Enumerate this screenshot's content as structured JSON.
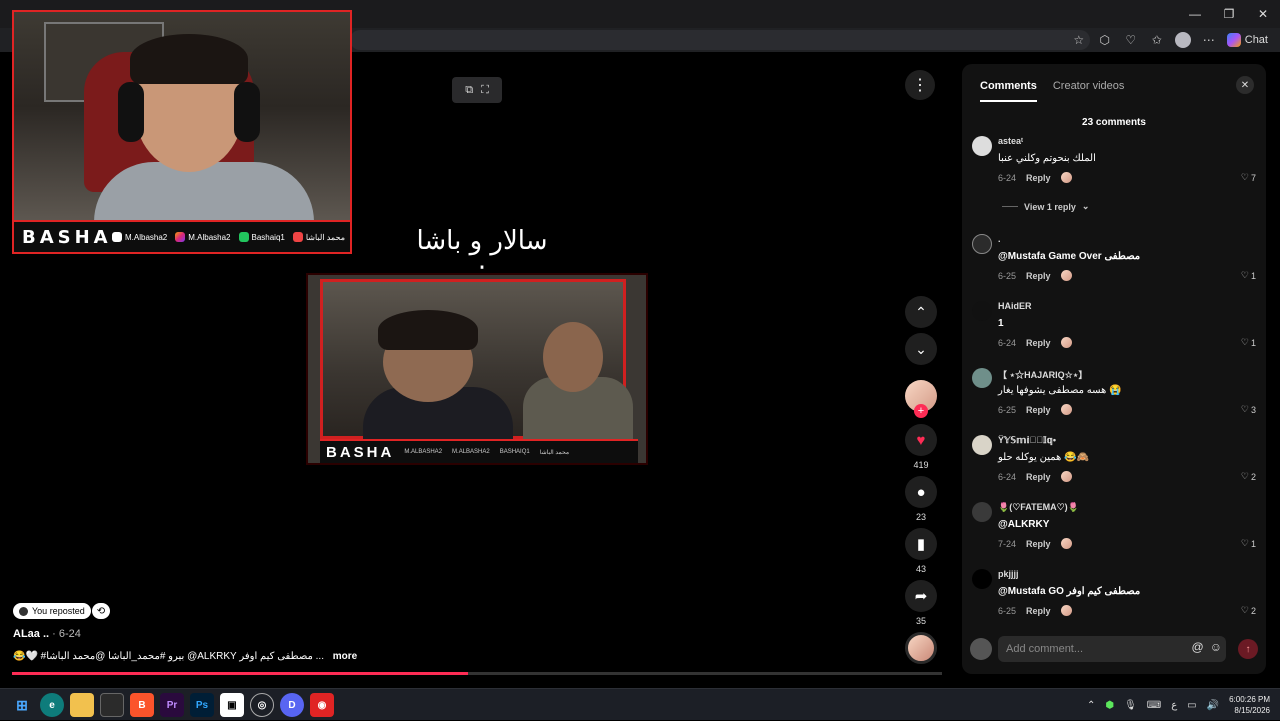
{
  "browser": {
    "chat_label": "Chat"
  },
  "webcam": {
    "brand": "BASHA",
    "socials": [
      "M.Albasha2",
      "M.Albasha2",
      "Bashaiq1",
      "محمد الباشا"
    ]
  },
  "video": {
    "caption": "سالار و باشا :",
    "inner_brand": "BASHA",
    "inner_socials": [
      "M.ALBASHA2",
      "M.ALBASHA2",
      "BASHAIQ1",
      "محمد الباشا"
    ],
    "likes": "419",
    "comments": "23",
    "saves": "43",
    "shares": "35",
    "reposted_label": "You reposted",
    "author": "ALaa ..",
    "date": "· 6-24",
    "description": "😂🤍 #بيرو #محمد_الباشا @محمد الباشا @ALKRKY مصطفى كيم اوفر ...",
    "more_label": "more",
    "progress": 0.49
  },
  "comments_panel": {
    "tabs": [
      "Comments",
      "Creator videos"
    ],
    "total": "23 comments",
    "reply_label": "Reply",
    "view_replies": "View 1 reply",
    "input_placeholder": "Add comment...",
    "comments": [
      {
        "user": "asteaᵗ",
        "text": "الملك بنحوتم وكلني عنبا",
        "date": "6-24",
        "likes": "7"
      },
      {
        "user": ".",
        "text": "@Mustafa Game Over مصطفى",
        "date": "6-25",
        "likes": "1"
      },
      {
        "user": "HAidER",
        "text": "1",
        "date": "6-24",
        "likes": "1"
      },
      {
        "user": "【 ⋆☆HAJARIQ☆⋆】",
        "text": "هسه مصطفى يشوفها يغار 😭",
        "date": "6-25",
        "likes": "3"
      },
      {
        "user": "Ÿ𝕐𝕊𝕞𝕚𝕟⃟𝕀𝕢•",
        "text": "همين يوكله حلو 😂🙈",
        "date": "6-24",
        "likes": "2"
      },
      {
        "user": "🌷(♡FATEMA♡)🌷",
        "text": "@ALKRKY",
        "date": "7-24",
        "likes": "1"
      },
      {
        "user": "pkjjjj",
        "text": "@Mustafa GO مصطفى كيم اوفر",
        "date": "6-25",
        "likes": "2"
      }
    ]
  },
  "taskbar": {
    "lang": "ع",
    "time": "6:00:26 PM",
    "date": "8/15/2026"
  },
  "colors": {
    "accent": "#fe2c55",
    "webcam_border": "#e02424",
    "panel_bg": "#121212"
  }
}
